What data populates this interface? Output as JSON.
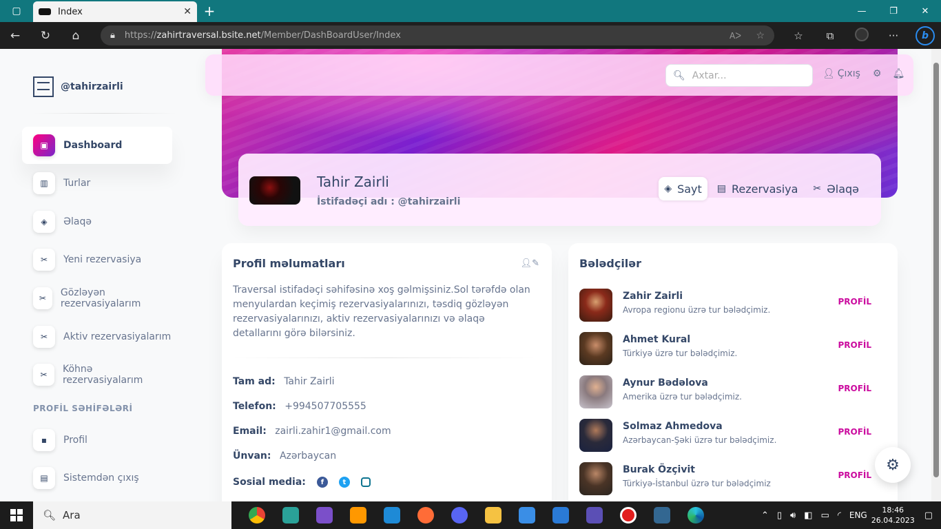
{
  "browser": {
    "tab_title": "Index",
    "url_prefix": "https://",
    "url_host": "zahirtraversal.bsite.net",
    "url_path": "/Member/DashBoardUser/Index"
  },
  "sidebar": {
    "brand": "@tahirzairli",
    "items": [
      {
        "label": "Dashboard",
        "icon": "shop-icon",
        "active": true
      },
      {
        "label": "Turlar",
        "icon": "chart-icon"
      },
      {
        "label": "Əlaqə",
        "icon": "box-icon"
      },
      {
        "label": "Yeni rezervasiya",
        "icon": "tools-icon"
      },
      {
        "label": "Gözləyən rezervasiyalarım",
        "icon": "tools-icon"
      },
      {
        "label": "Aktiv rezervasiyalarım",
        "icon": "tools-icon"
      },
      {
        "label": "Köhnə rezervasiyalarım",
        "icon": "tools-icon"
      }
    ],
    "section_label": "PROFİL SƏHİFƏLƏRİ",
    "profile_items": [
      {
        "label": "Profil",
        "icon": "user-card-icon"
      },
      {
        "label": "Sistemdən çıxış",
        "icon": "document-icon"
      }
    ]
  },
  "topnav": {
    "search_placeholder": "Axtar...",
    "logout_label": "Çıxış"
  },
  "profile": {
    "name": "Tahir Zairli",
    "username_line": "İstifadəçi adı : @tahirzairli",
    "tabs": [
      "Sayt",
      "Rezervasiya",
      "Əlaqə"
    ]
  },
  "info_card": {
    "title": "Profil məlumatları",
    "about": "Traversal istifadəçi səhifəsinə xoş gəlmişsiniz.Sol tərəfdə olan menyulardan keçimiş rezervasiyalarınızı, təsdiq gözləyən rezervasiyalarınızı, aktiv rezervasiyalarınızı və əlaqə detallarını görə bilərsiniz.",
    "fields": [
      {
        "label": "Tam ad:",
        "value": "Tahir Zairli"
      },
      {
        "label": "Telefon:",
        "value": "+994507705555"
      },
      {
        "label": "Email:",
        "value": "zairli.zahir1@gmail.com"
      },
      {
        "label": "Ünvan:",
        "value": "Azərbaycan"
      }
    ],
    "social_label": "Sosial media:"
  },
  "guides_card": {
    "title": "Bələdçilər",
    "link_label": "PROFİL",
    "guides": [
      {
        "name": "Zahir Zairli",
        "desc": "Avropa regionu üzrə tur bələdçimiz."
      },
      {
        "name": "Ahmet Kural",
        "desc": "Türkiyə üzrə tur bələdçimiz."
      },
      {
        "name": "Aynur Bədəlova",
        "desc": "Amerika üzrə tur bələdçimiz."
      },
      {
        "name": "Solmaz Ahmedova",
        "desc": "Azərbaycan-Şəki üzrə tur bələdçimiz."
      },
      {
        "name": "Burak Özçivit",
        "desc": "Türkiyə-İstanbul üzrə tur bələdçimiz"
      }
    ]
  },
  "taskbar": {
    "search_label": "Ara",
    "lang": "ENG",
    "time": "18:46",
    "date": "26.04.2023"
  },
  "colors": {
    "accent": "#cb0c9f",
    "text_dark": "#344767",
    "text_muted": "#67748e"
  }
}
